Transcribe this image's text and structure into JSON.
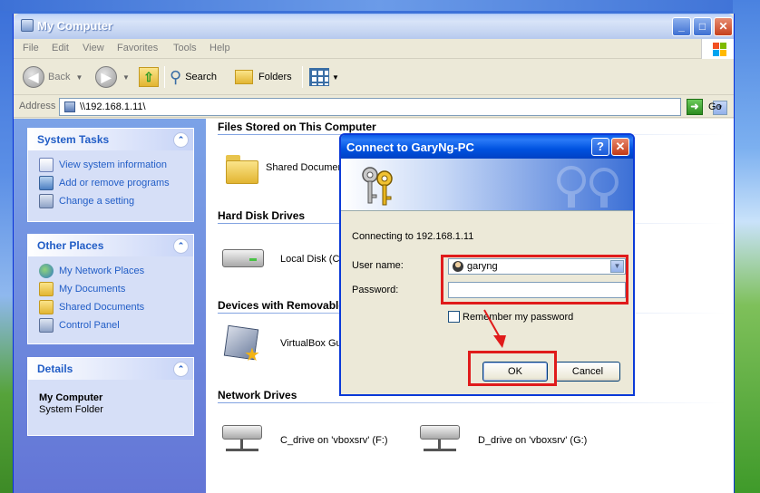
{
  "window": {
    "title": "My Computer",
    "controls": {
      "minimize": "_",
      "maximize": "□",
      "close": "✕"
    }
  },
  "menu": [
    "File",
    "Edit",
    "View",
    "Favorites",
    "Tools",
    "Help"
  ],
  "toolbar": {
    "back": "Back",
    "search": "Search",
    "folders": "Folders"
  },
  "address": {
    "label": "Address",
    "value": "\\\\192.168.1.11\\",
    "go": "Go"
  },
  "left_pane": {
    "system_tasks": {
      "title": "System Tasks",
      "items": [
        "View system information",
        "Add or remove programs",
        "Change a setting"
      ]
    },
    "other_places": {
      "title": "Other Places",
      "items": [
        "My Network Places",
        "My Documents",
        "Shared Documents",
        "Control Panel"
      ]
    },
    "details": {
      "title": "Details",
      "name": "My Computer",
      "type": "System Folder"
    }
  },
  "content": {
    "groups": {
      "files": "Files Stored on This Computer",
      "hdd": "Hard Disk Drives",
      "removable": "Devices with Removable",
      "network": "Network Drives"
    },
    "items": {
      "shared": "Shared Documen",
      "local_disk": "Local Disk (C:)",
      "vbox": "VirtualBox Guest",
      "c_drive": "C_drive on 'vboxsrv' (F:)",
      "d_drive": "D_drive on 'vboxsrv' (G:)"
    }
  },
  "dialog": {
    "title": "Connect to GaryNg-PC",
    "help": "?",
    "close": "✕",
    "connecting": "Connecting to 192.168.1.11",
    "username_label": "User name:",
    "username_value": "garyng",
    "password_label": "Password:",
    "password_value": "",
    "remember": "Remember my password",
    "remember_checked": false,
    "ok": "OK",
    "cancel": "Cancel"
  },
  "colors": {
    "annotation": "#e01b1b",
    "xp_blue": "#0b3ad8",
    "link": "#215dc6"
  }
}
